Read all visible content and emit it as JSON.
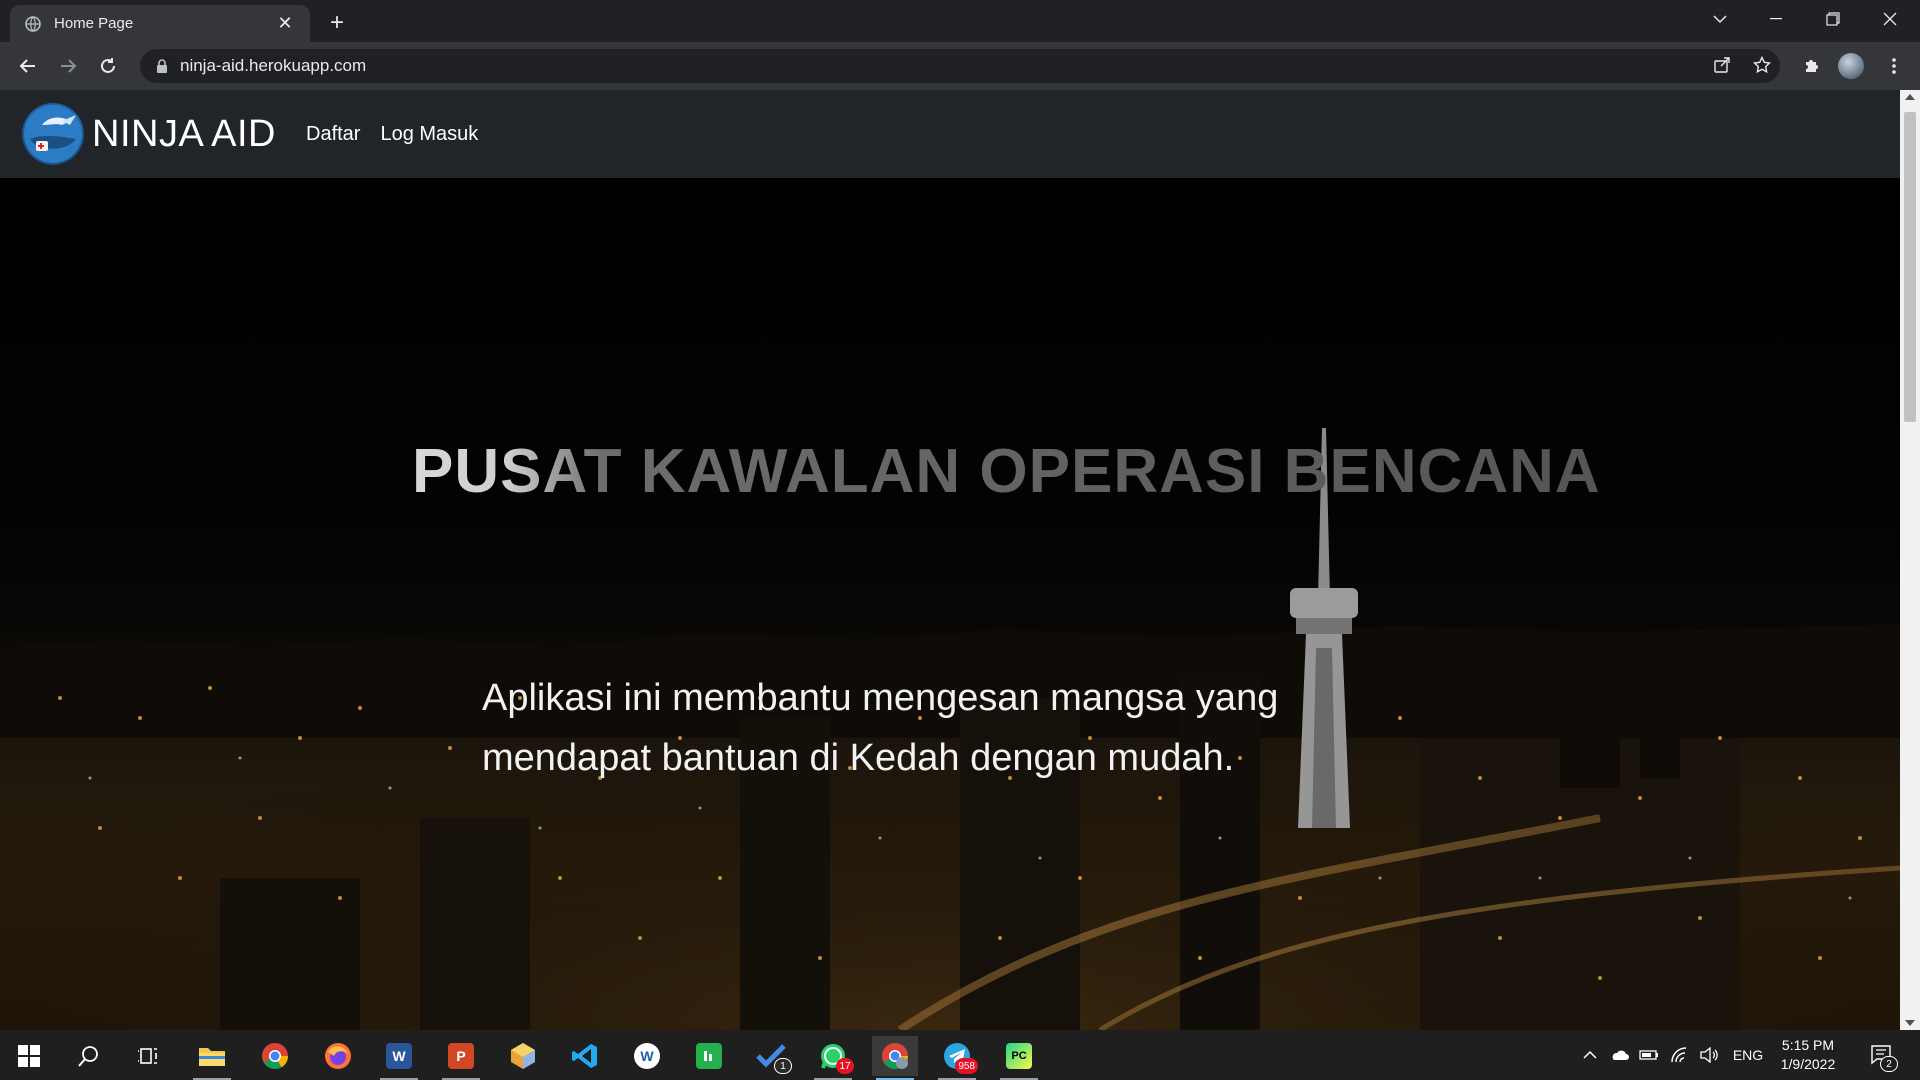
{
  "browser": {
    "tab_title": "Home Page",
    "tab_close": "✕",
    "new_tab": "+",
    "url": "ninja-aid.herokuapp.com",
    "window_controls": {
      "tab_search": "⌄",
      "minimize": "—",
      "restore": "❐",
      "close": "✕"
    },
    "nav": {
      "back": "←",
      "forward": "→",
      "reload": "↻"
    },
    "toolbar_icons": {
      "share": "share-icon",
      "bookmark": "☆",
      "extensions": "puzzle-icon",
      "menu": "⋮"
    }
  },
  "site": {
    "brand": "NINJA AID",
    "nav_links": [
      "Daftar",
      "Log Masuk"
    ],
    "hero_title": "PUSAT KAWALAN OPERASI BENCANA",
    "hero_subtitle_line1": "Aplikasi ini membantu mengesan mangsa yang",
    "hero_subtitle_line2": "mendapat bantuan di Kedah dengan mudah."
  },
  "taskbar": {
    "apps": [
      {
        "name": "start",
        "label": ""
      },
      {
        "name": "search",
        "label": ""
      },
      {
        "name": "task-view",
        "label": ""
      },
      {
        "name": "file-explorer",
        "label": ""
      },
      {
        "name": "chrome",
        "label": ""
      },
      {
        "name": "firefox",
        "label": ""
      },
      {
        "name": "word",
        "label": "W"
      },
      {
        "name": "powerpoint",
        "label": "P"
      },
      {
        "name": "app-cube",
        "label": ""
      },
      {
        "name": "vscode",
        "label": ""
      },
      {
        "name": "w-app",
        "label": "W"
      },
      {
        "name": "green-app",
        "label": ""
      },
      {
        "name": "todo",
        "label": "✔"
      },
      {
        "name": "whatsapp",
        "label": ""
      },
      {
        "name": "chrome-active",
        "label": ""
      },
      {
        "name": "telegram",
        "label": ""
      },
      {
        "name": "pycharm",
        "label": "PC"
      }
    ],
    "badges": {
      "todo": "1",
      "whatsapp": "17",
      "telegram": "958"
    },
    "tray": {
      "language": "ENG",
      "time": "5:15 PM",
      "date": "1/9/2022",
      "notifications": "2"
    }
  }
}
